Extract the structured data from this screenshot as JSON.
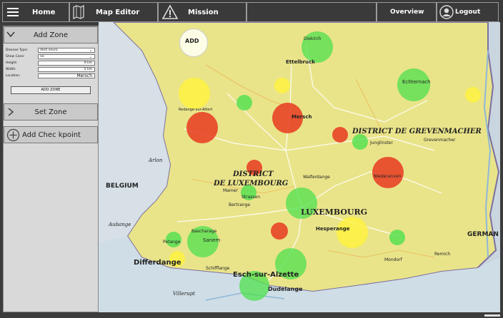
{
  "topbar": {
    "home": "Home",
    "map_editor": "Map Editor",
    "mission": "Mission",
    "overview": "Overview",
    "logout": "Logout"
  },
  "sidebar": {
    "add_zone": {
      "title": "Add Zone",
      "fields": [
        {
          "label": "Disease Type:",
          "value": "dent neuro"
        },
        {
          "label": "Show Cone:",
          "value": "no"
        },
        {
          "label": "Height:",
          "value": "9 km"
        },
        {
          "label": "Width:",
          "value": "5 km"
        },
        {
          "label": "Location:",
          "value": "Mersch"
        }
      ],
      "button": "ADD ZONE"
    },
    "set_zone": "Set Zone",
    "add_checkpoint": "Add Chec kpoint"
  },
  "map": {
    "add_label": "ADD",
    "labels": {
      "belgium": "BELGIUM",
      "germany": "GERMAN",
      "district_lux_1": "DISTRICT",
      "district_lux_2": "DE LUXEMBOURG",
      "district_grev": "DISTRICT DE GREVENMACHER",
      "luxembourg": "LUXEMBOURG",
      "differdange": "Differdange",
      "esch": "Esch-sur-Alzette",
      "dudelange": "Dudelange",
      "villerupt": "Villerupt",
      "arlon": "Arlon",
      "aubange": "Aubange",
      "ettelbruck": "Ettelbruck",
      "mersch": "Mersch",
      "echternach": "Echternach",
      "hesperange": "Hesperange",
      "diekirch": "Diekirch",
      "bertrange": "Bertrange",
      "mamer": "Mamer",
      "strassen": "Strassen",
      "petange": "Petange",
      "walferdange": "Walferdange",
      "junglinster": "Junglinster",
      "niederanven": "Niederanven",
      "sanem": "Sanem",
      "bascharage": "Bascharage",
      "redange": "Redange-sur-Attert",
      "remich": "Remich",
      "mondorf": "Mondorf",
      "schifflange": "Schifflange",
      "grevenmacher": "Grevenmacher"
    },
    "colors": {
      "land": "#e9e48a",
      "water": "#c8d8e4",
      "border": "#7d6fa0",
      "green": "#4ee04e",
      "red": "#e83a20",
      "yellow": "#fff23c"
    }
  }
}
